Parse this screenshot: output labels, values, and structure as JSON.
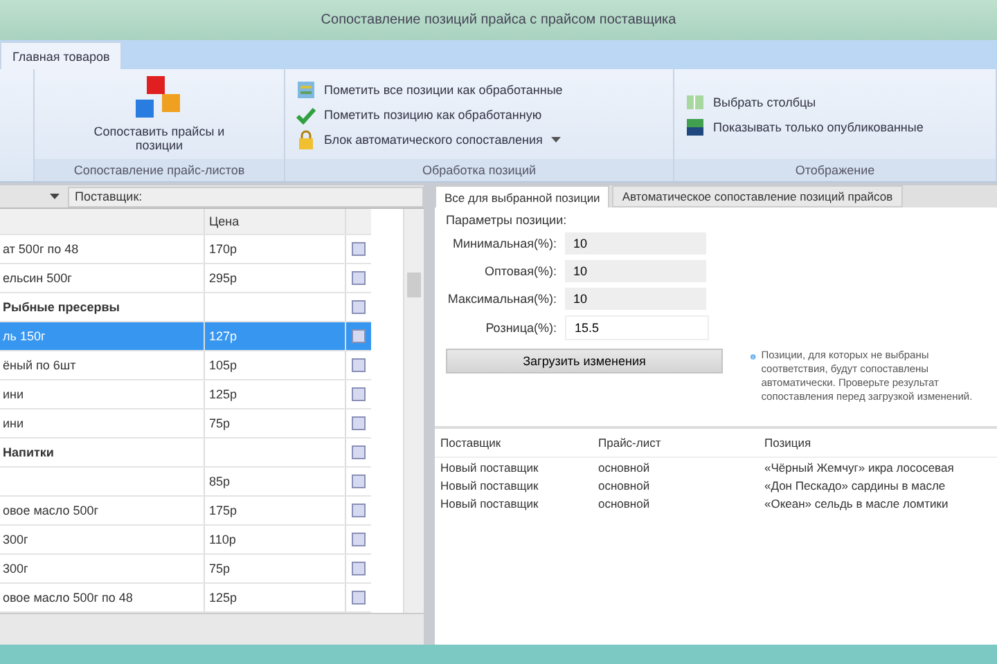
{
  "window": {
    "title": "Сопоставление позиций прайса с прайсом поставщика"
  },
  "ribbon_tabs": [
    {
      "label": "Главная товаров",
      "selected": true
    }
  ],
  "ribbon_groups": [
    {
      "label": "Сопоставление прайс-листов",
      "buttons": [
        {
          "kind": "large",
          "label": "Сопоставить прайсы и позиции"
        }
      ]
    },
    {
      "label": "Обработка позиций",
      "buttons": [
        {
          "kind": "small",
          "label": "Пометить все позиции как обработанные"
        },
        {
          "kind": "small",
          "label": "Пометить позицию как обработанную"
        },
        {
          "kind": "dropdown",
          "label": "Блок автоматического сопоставления"
        }
      ]
    },
    {
      "label": "Отображение",
      "buttons": [
        {
          "kind": "small",
          "label": "Выбрать столбцы"
        },
        {
          "kind": "small",
          "label": "Показывать только опубликованные"
        }
      ]
    }
  ],
  "left_panel": {
    "filter_label": "Поставщик:",
    "columns": [
      "Цена"
    ],
    "rows": [
      {
        "kind": "item",
        "name": "ат 500г по 48",
        "price": "170р",
        "checked": false,
        "selected": false
      },
      {
        "kind": "item",
        "name": "ельсин 500г",
        "price": "295р",
        "checked": false,
        "selected": false
      },
      {
        "kind": "group",
        "name": "Рыбные пресервы",
        "checked": false,
        "selected": false
      },
      {
        "kind": "item",
        "name": "ль 150г",
        "price": "127р",
        "checked": false,
        "selected": true
      },
      {
        "kind": "item",
        "name": "ёный по 6шт",
        "price": "105р",
        "checked": false,
        "selected": false
      },
      {
        "kind": "item",
        "name": "ини",
        "price": "125р",
        "checked": false,
        "selected": false
      },
      {
        "kind": "item",
        "name": "ини",
        "price": "75р",
        "checked": false,
        "selected": false
      },
      {
        "kind": "group",
        "name": "Напитки",
        "checked": false,
        "selected": false
      },
      {
        "kind": "item",
        "price": "85р",
        "checked": false,
        "selected": false
      },
      {
        "kind": "item",
        "name": "овое масло 500г",
        "price": "175р",
        "checked": false,
        "selected": false
      },
      {
        "kind": "item",
        "name": "300г",
        "price": "110р",
        "checked": false,
        "selected": false
      },
      {
        "kind": "item",
        "name": "300г",
        "price": "75р",
        "checked": false,
        "selected": false
      },
      {
        "kind": "item",
        "name": "овое масло 500г по 48",
        "price": "125р",
        "checked": false,
        "selected": false
      }
    ]
  },
  "right_tabs": [
    {
      "label": "Все для выбранной позиции",
      "selected": true
    },
    {
      "label": "Автоматическое сопоставление позиций прайсов",
      "selected": false
    }
  ],
  "parameters": {
    "title": "Параметры позиции:",
    "fields": [
      {
        "label": "Минимальная(%):",
        "value": "10"
      },
      {
        "label": "Оптовая(%):",
        "value": "10"
      },
      {
        "label": "Максимальная(%):",
        "value": "10"
      },
      {
        "label": "Розница(%):",
        "value": "15.5"
      }
    ],
    "button": "Загрузить изменения",
    "info": "Позиции, для которых не выбраны соответствия, будут сопоставлены автоматически. Проверьте результат сопоставления перед загрузкой изменений."
  },
  "matches": {
    "columns": [
      "Поставщик",
      "Прайс-лист",
      "Позиция"
    ],
    "rows": [
      [
        "Новый поставщик",
        "основной",
        "«Чёрный Жемчуг» икра лососевая"
      ],
      [
        "Новый поставщик",
        "основной",
        "«Дон Пескадо» сардины в масле"
      ],
      [
        "Новый поставщик",
        "основной",
        "«Океан» сельдь в масле ломтики"
      ]
    ]
  }
}
